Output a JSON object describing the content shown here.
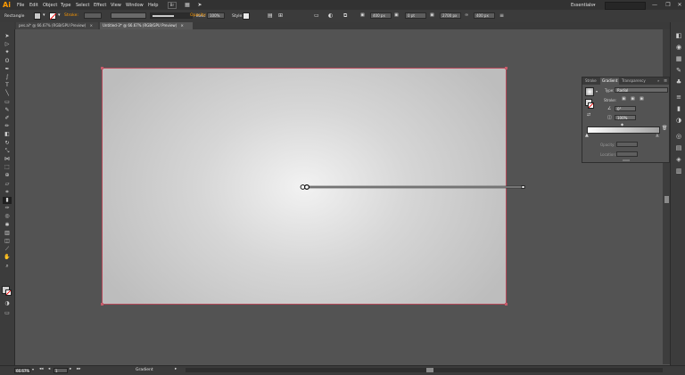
{
  "app": {
    "logo": "Ai"
  },
  "menu": {
    "items": [
      "File",
      "Edit",
      "Object",
      "Type",
      "Select",
      "Effect",
      "View",
      "Window",
      "Help"
    ]
  },
  "workspace": {
    "label": "Essentials",
    "caret": "▾"
  },
  "window_controls": {
    "minimize": "—",
    "maximize": "❐",
    "close": "✕"
  },
  "control_bar": {
    "tool_name": "Rectangle",
    "stroke_label": "Stroke:",
    "basic_label": "Basic",
    "opacity_label": "Opacity:",
    "opacity_value": "100%",
    "style_label": "Style:",
    "corner_value": "0 pt",
    "w_value": "400 px",
    "h_value": "2700 px",
    "x_value": "400 px",
    "y_value": "400 px"
  },
  "tabs": [
    {
      "label": "pes.ai* @ 66.67% (RGB/GPU Preview)",
      "close": "×"
    },
    {
      "label": "Untitled-3* @ 66.67% (RGB/GPU Preview)",
      "close": "×"
    }
  ],
  "toolbar_icons": [
    "selection-icon",
    "direct-selection-icon",
    "magic-wand-icon",
    "lasso-icon",
    "pen-icon",
    "curvature-icon",
    "type-icon",
    "line-icon",
    "rectangle-icon",
    "paintbrush-icon",
    "shaper-icon",
    "pencil-icon",
    "eraser-icon",
    "rotate-icon",
    "scale-icon",
    "width-icon",
    "free-transform-icon",
    "shape-builder-icon",
    "perspective-icon",
    "mesh-icon",
    "gradient-icon",
    "eyedropper-icon",
    "blend-icon",
    "symbol-sprayer-icon",
    "column-graph-icon",
    "artboard-icon",
    "slice-icon",
    "hand-icon",
    "zoom-icon"
  ],
  "gradient_panel": {
    "tabs": [
      "Stroke",
      "Gradient",
      "Transparency"
    ],
    "type_label": "Type:",
    "type_value": "Radial",
    "stroke_label": "Stroke:",
    "angle_value": "0°",
    "ratio_value": "100%",
    "opacity_label": "Opacity:",
    "location_label": "Location:"
  },
  "status_bar": {
    "zoom": "66.67%",
    "artboard_num": "1",
    "tool_label": "Gradient",
    "nav_prev": "◂",
    "nav_next": "▸"
  },
  "colors": {
    "artboard_border": "#b54a5a",
    "accent": "#ff9a00"
  }
}
